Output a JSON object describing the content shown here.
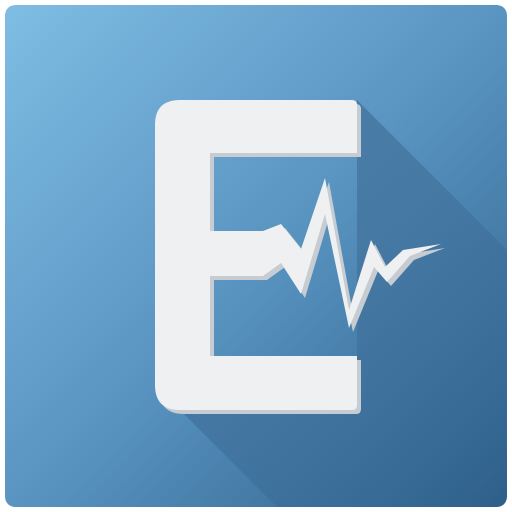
{
  "icon": {
    "name": "e-pulse-app-icon",
    "glyph": "E",
    "colors": {
      "background_light": "#7fbde3",
      "background_mid": "#5a95c2",
      "background_dark": "#2d5f89",
      "long_shadow": "#284f74",
      "glyph_fill": "#eef0f1",
      "glyph_edge": "#c6ccd1"
    }
  }
}
